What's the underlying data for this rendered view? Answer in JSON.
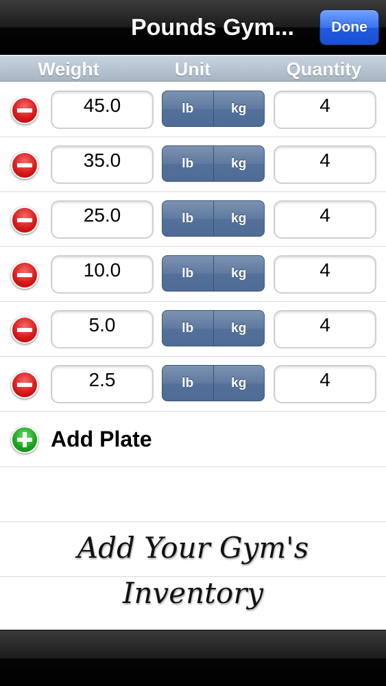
{
  "nav": {
    "title": "Pounds Gym...",
    "done_label": "Done"
  },
  "columns": {
    "weight": "Weight",
    "unit": "Unit",
    "quantity": "Quantity"
  },
  "plates": [
    {
      "weight": "45.0",
      "unit_lb": "lb",
      "unit_kg": "kg",
      "quantity": "4"
    },
    {
      "weight": "35.0",
      "unit_lb": "lb",
      "unit_kg": "kg",
      "quantity": "4"
    },
    {
      "weight": "25.0",
      "unit_lb": "lb",
      "unit_kg": "kg",
      "quantity": "4"
    },
    {
      "weight": "10.0",
      "unit_lb": "lb",
      "unit_kg": "kg",
      "quantity": "4"
    },
    {
      "weight": "5.0",
      "unit_lb": "lb",
      "unit_kg": "kg",
      "quantity": "4"
    },
    {
      "weight": "2.5",
      "unit_lb": "lb",
      "unit_kg": "kg",
      "quantity": "4"
    }
  ],
  "add_plate_label": "Add Plate",
  "caption": {
    "line1": "Add Your Gym's",
    "line2": "Inventory"
  },
  "icons": {
    "delete": "minus-circle-icon",
    "add": "plus-circle-icon"
  },
  "colors": {
    "done_button": "#2f6af0",
    "segment": "#5f7aa0",
    "delete": "#d91c1c",
    "add": "#1ea61e"
  }
}
